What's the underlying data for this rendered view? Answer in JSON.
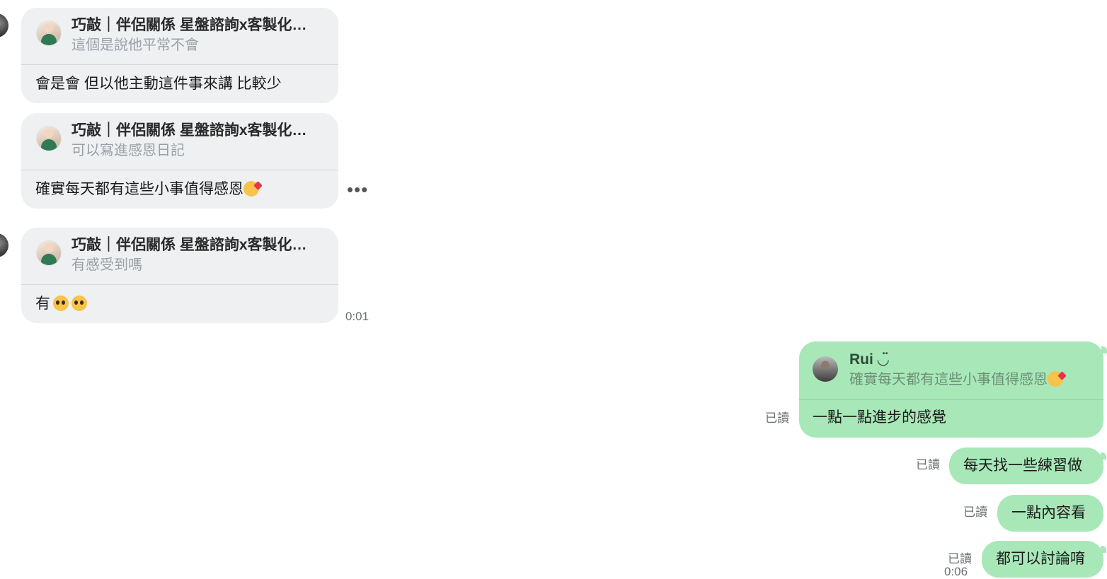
{
  "incoming": [
    {
      "quoted_name": "巧敲｜伴侶關係 星盤諮詢x客製化…",
      "quoted_text": "這個是說他平常不會",
      "message": "會是會 但以他主動這件事來講 比較少"
    },
    {
      "quoted_name": "巧敲｜伴侶關係 星盤諮詢x客製化…",
      "quoted_text": "可以寫進感恩日記",
      "message": "確實每天都有這些小事值得感恩",
      "emoji": "smiling-face-with-hearts"
    },
    {
      "quoted_name": "巧敲｜伴侶關係 星盤諮詢x客製化…",
      "quoted_text": "有感受到嗎",
      "message": "有",
      "emoji": "pleading-face x2",
      "time": "0:01"
    }
  ],
  "more_options_label": "•••",
  "outgoing": [
    {
      "quoted_name": "Rui ◡̈",
      "quoted_text": "確實每天都有這些小事值得感恩",
      "message": "一點一點進步的感覺",
      "read": "已讀"
    },
    {
      "message": "每天找一些練習做",
      "read": "已讀"
    },
    {
      "message": "一點內容看",
      "read": "已讀"
    },
    {
      "message": "都可以討論唷",
      "read": "已讀",
      "time": "0:06"
    }
  ],
  "colors": {
    "incoming_bubble": "#eef0f2",
    "outgoing_bubble": "#a8e8b8",
    "meta_text": "#6b6f74"
  }
}
